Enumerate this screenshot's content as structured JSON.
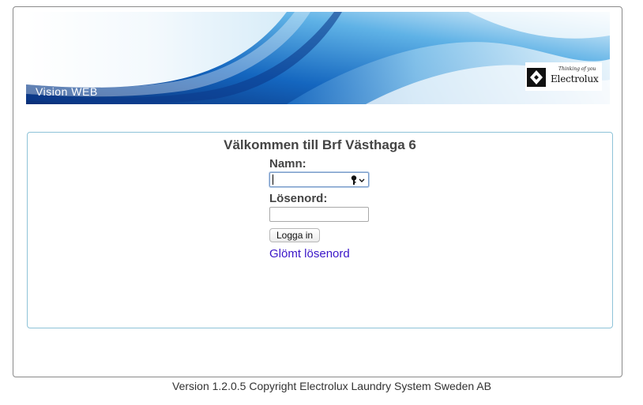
{
  "banner": {
    "title": "Vision WEB",
    "logo": {
      "brand": "Electrolux",
      "tagline": "Thinking of you"
    },
    "colors": {
      "deep_blue": "#0b3a8c",
      "mid_blue": "#1f7fd0",
      "light_blue": "#bfe0f4"
    }
  },
  "login": {
    "welcome": "Välkommen till Brf Västhaga 6",
    "name_label": "Namn:",
    "name_value": "",
    "password_label": "Lösenord:",
    "password_value": "",
    "submit_label": "Logga in",
    "forgot_link": "Glömt lösenord",
    "key_icon": "key-icon",
    "link_color": "#3a16c8"
  },
  "footer": {
    "text": "Version 1.2.0.5 Copyright Electrolux Laundry System Sweden AB"
  }
}
